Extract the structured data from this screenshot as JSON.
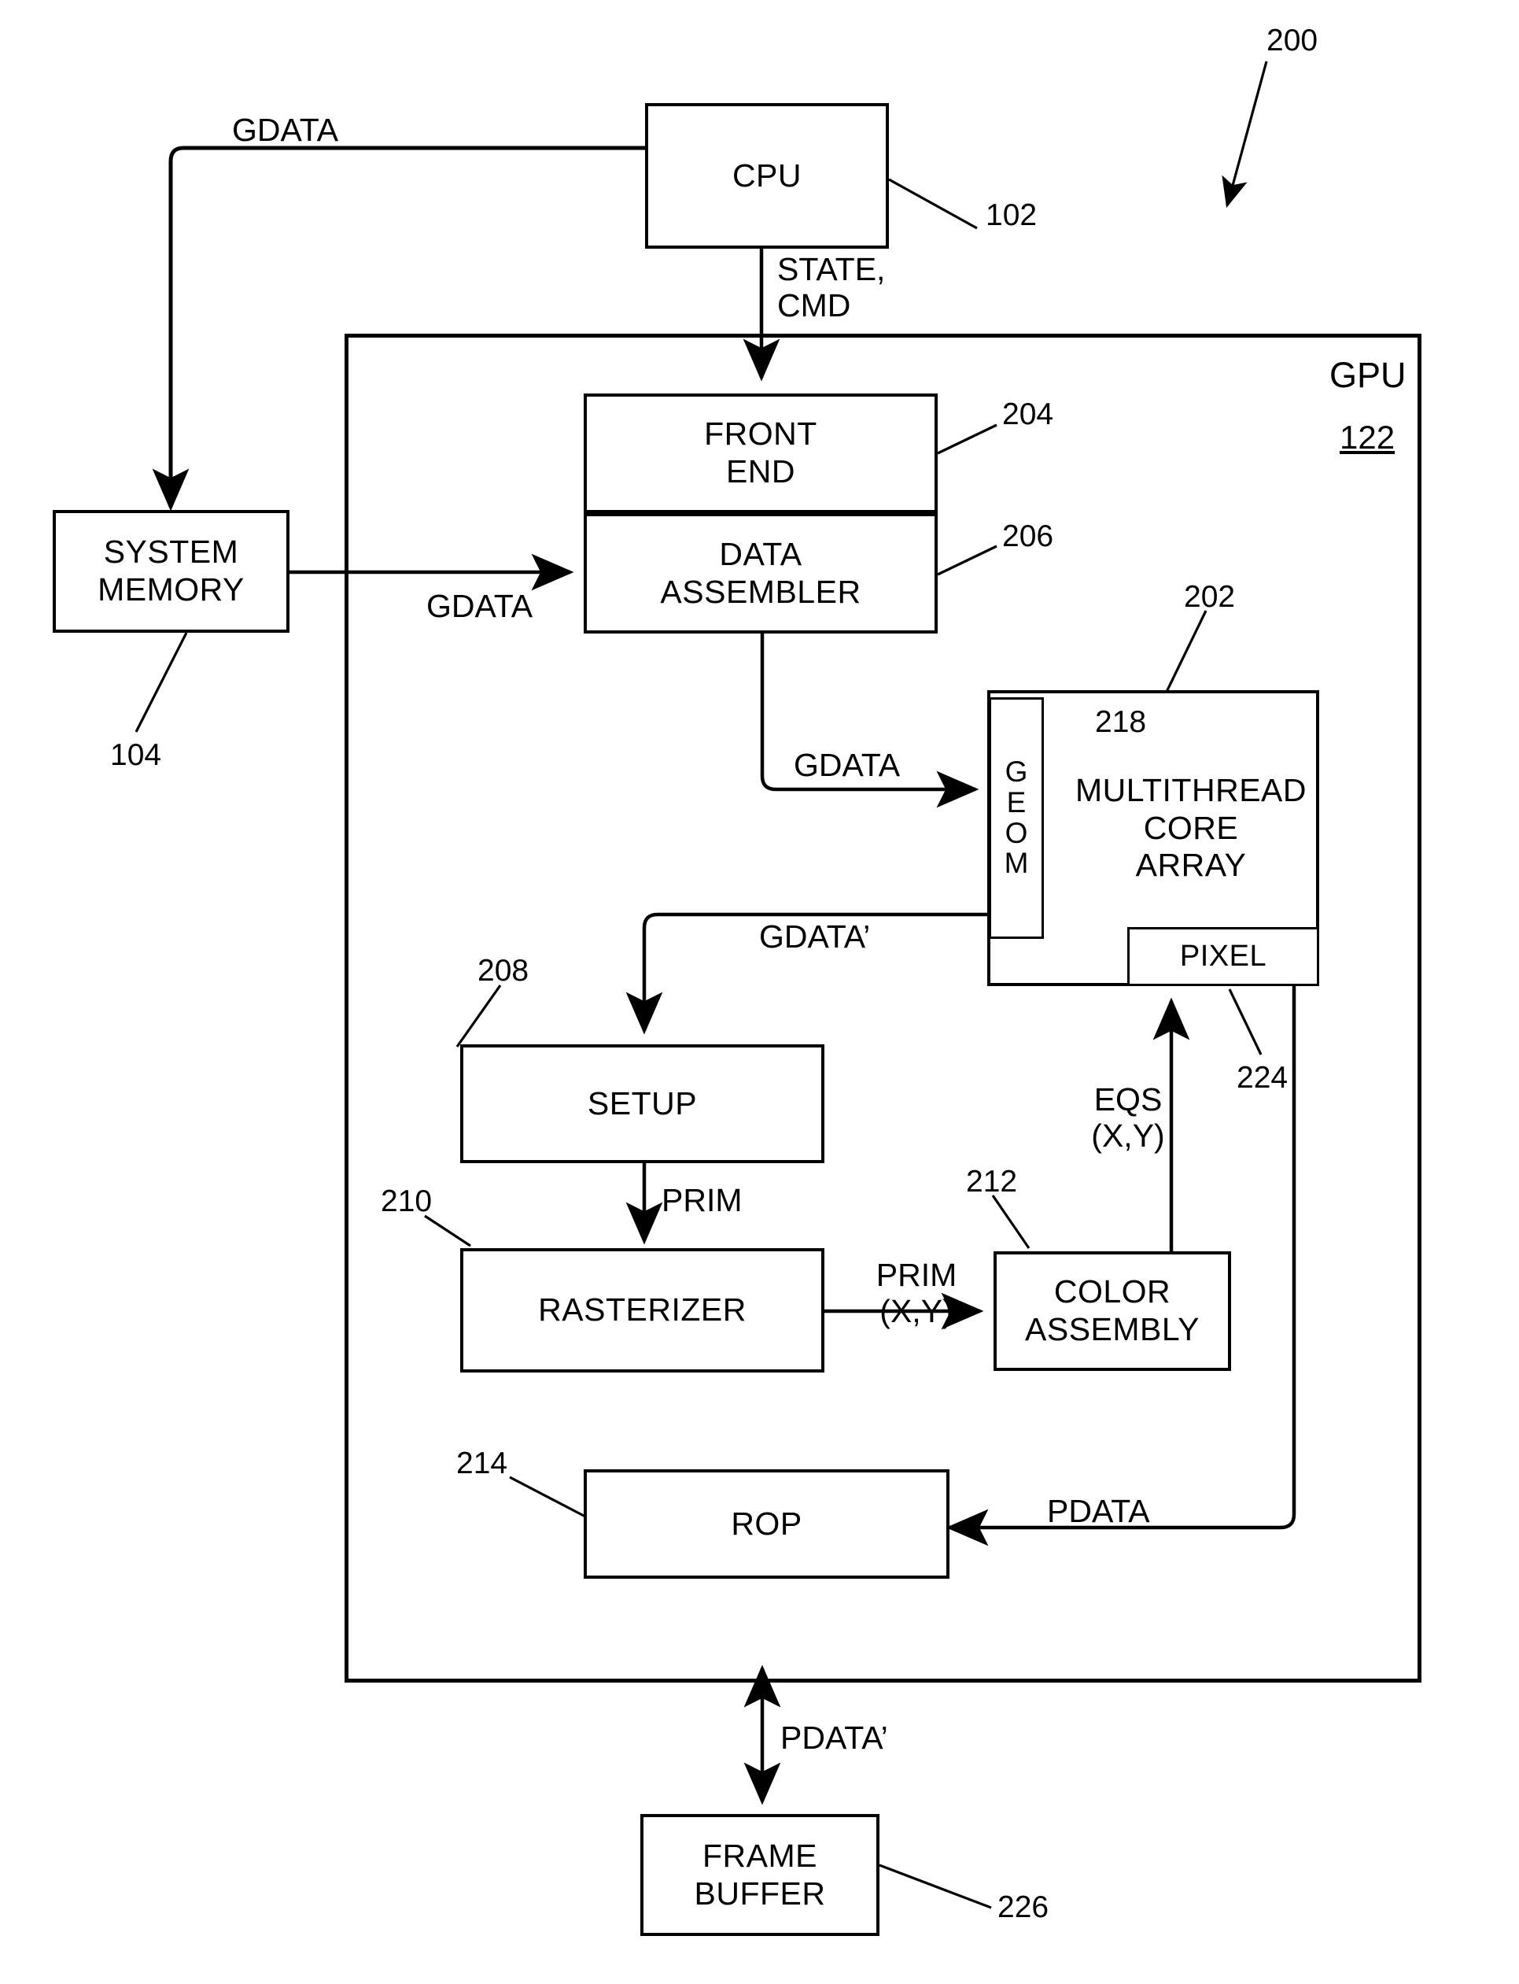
{
  "figure": {
    "number": "200",
    "domain": "gpu-rendering-pipeline-block-diagram"
  },
  "blocks": {
    "cpu": {
      "label": "CPU",
      "ref": "102"
    },
    "system_memory": {
      "label": "SYSTEM\nMEMORY",
      "ref": "104"
    },
    "gpu": {
      "label": "GPU",
      "ref": "122"
    },
    "front_end": {
      "label": "FRONT\nEND",
      "ref": "204"
    },
    "data_assembler": {
      "label": "DATA\nASSEMBLER",
      "ref": "206"
    },
    "core_array": {
      "label": "MULTITHREAD\nCORE\nARRAY",
      "ref": "202"
    },
    "geom": {
      "label": "G\nE\nO\nM",
      "ref": "218"
    },
    "pixel": {
      "label": "PIXEL",
      "ref": "224"
    },
    "setup": {
      "label": "SETUP",
      "ref": "208"
    },
    "rasterizer": {
      "label": "RASTERIZER",
      "ref": "210"
    },
    "color_assembly": {
      "label": "COLOR\nASSEMBLY",
      "ref": "212"
    },
    "rop": {
      "label": "ROP",
      "ref": "214"
    },
    "frame_buffer": {
      "label": "FRAME\nBUFFER",
      "ref": "226"
    }
  },
  "signals": {
    "gdata_cpu_to_memory": "GDATA",
    "state_cmd": "STATE,\nCMD",
    "gdata_memory_to_assembler": "GDATA",
    "gdata_assembler_to_geom": "GDATA",
    "gdata_prime_geom_to_setup": "GDATA’",
    "prim_setup_to_rasterizer": "PRIM",
    "prim_xy_raster_to_color": "PRIM\n(X,Y)",
    "eqs_xy_color_to_pixel": "EQS\n(X,Y)",
    "pdata_pixel_to_rop": "PDATA",
    "pdata_prime_rop_to_fb": "PDATA’"
  },
  "style": {
    "ink": "#000000",
    "paper": "#ffffff"
  }
}
